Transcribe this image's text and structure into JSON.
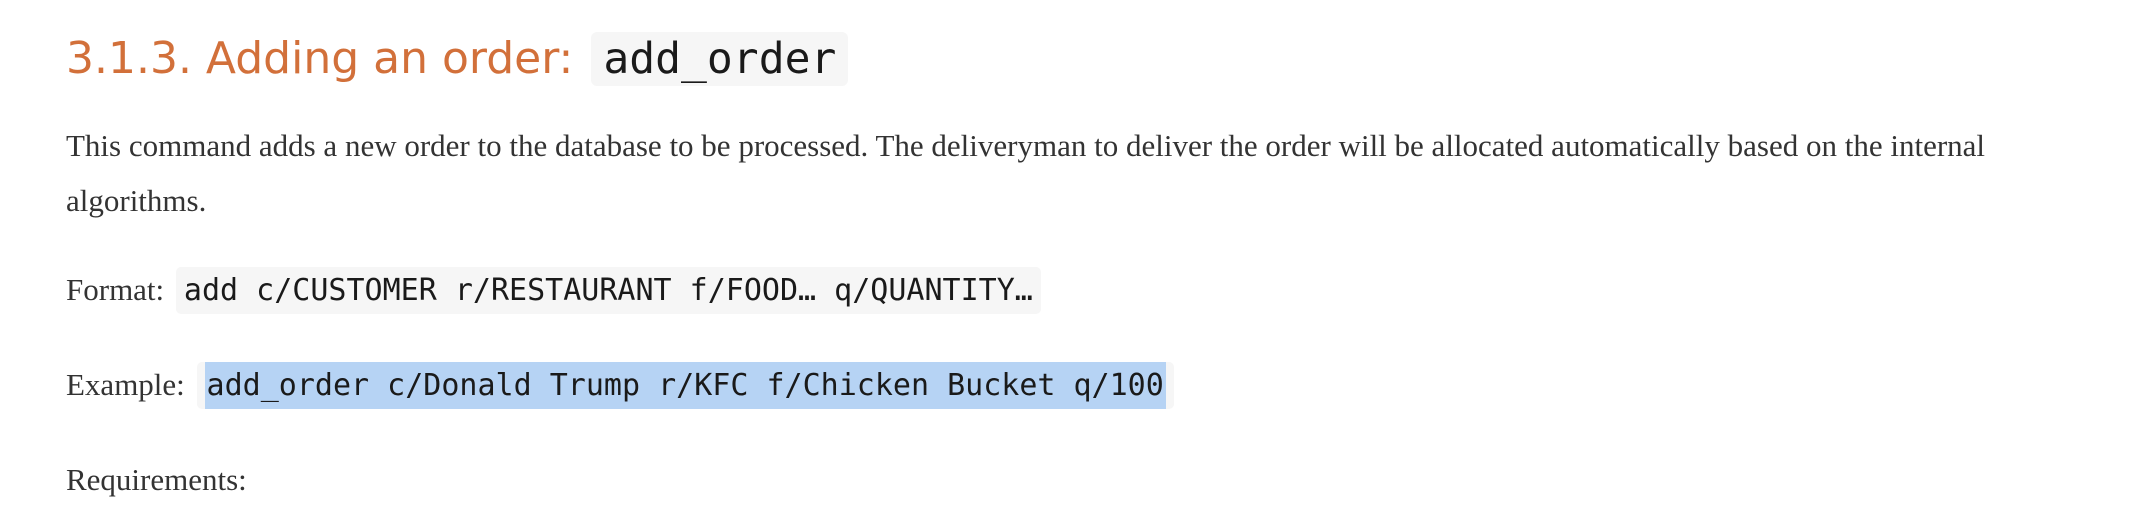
{
  "section": {
    "heading_number_title": "3.1.3. Adding an order:",
    "heading_code": "add_order"
  },
  "description": "This command adds a new order to the database to be processed. The deliveryman to deliver the order will be allocated automatically based on the internal algorithms.",
  "format": {
    "label": "Format:",
    "code": "add c/CUSTOMER r/RESTAURANT f/FOOD… q/QUANTITY…"
  },
  "example": {
    "label": "Example:",
    "code": "add_order c/Donald Trump r/KFC f/Chicken Bucket q/100",
    "selected": true
  },
  "requirements": {
    "label": "Requirements:"
  }
}
